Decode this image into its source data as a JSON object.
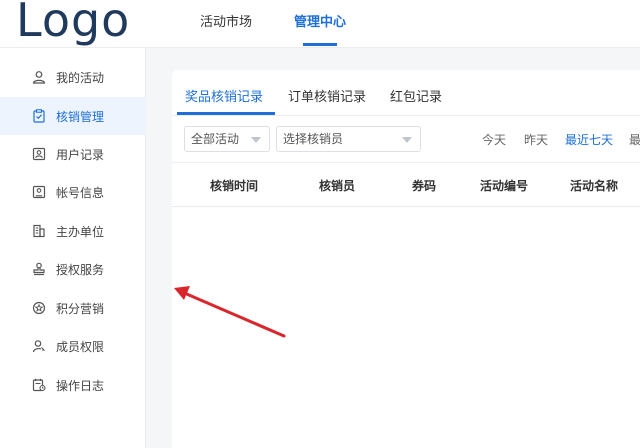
{
  "logo": "Logo",
  "top_nav": [
    {
      "label": "活动市场"
    },
    {
      "label": "管理中心"
    }
  ],
  "sidebar": {
    "items": [
      {
        "label": "我的活动",
        "icon": "user-icon"
      },
      {
        "label": "核销管理",
        "icon": "clipboard-check-icon"
      },
      {
        "label": "用户记录",
        "icon": "user-card-icon"
      },
      {
        "label": "帐号信息",
        "icon": "id-card-icon"
      },
      {
        "label": "主办单位",
        "icon": "building-icon"
      },
      {
        "label": "授权服务",
        "icon": "stamp-icon"
      },
      {
        "label": "积分营销",
        "icon": "points-icon"
      },
      {
        "label": "成员权限",
        "icon": "member-key-icon"
      },
      {
        "label": "操作日志",
        "icon": "log-icon"
      }
    ]
  },
  "tabs": [
    {
      "label": "奖品核销记录"
    },
    {
      "label": "订单核销记录"
    },
    {
      "label": "红包记录"
    }
  ],
  "filters": {
    "activity_select": "全部活动",
    "verifier_select": "选择核销员",
    "dates": [
      "今天",
      "昨天",
      "最近七天",
      "最"
    ]
  },
  "table": {
    "columns": [
      "核销时间",
      "核销员",
      "券码",
      "活动编号",
      "活动名称"
    ]
  },
  "colors": {
    "accent": "#1e6fd9",
    "logo": "#1f3a5c",
    "annotation_arrow": "#d9262c"
  }
}
